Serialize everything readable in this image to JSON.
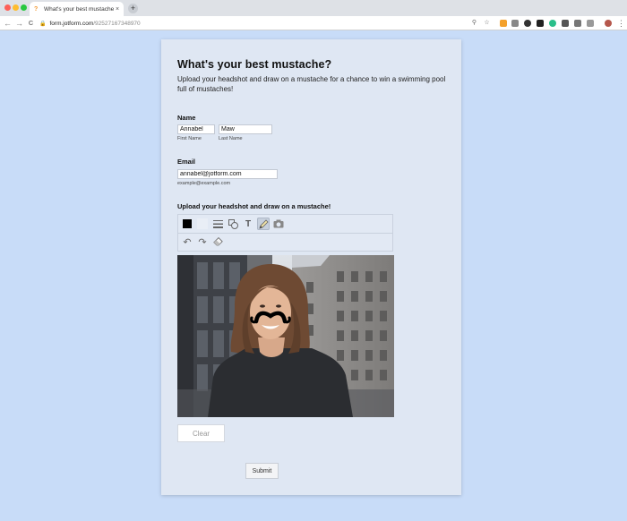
{
  "browser": {
    "tab_title": "What's your best mustache?",
    "tab_close": "×",
    "new_tab": "+",
    "url_host": "form.jotform.com",
    "url_path": "/92527167348970",
    "back": "←",
    "forward": "→",
    "reload": "C"
  },
  "form": {
    "title": "What's your best mustache?",
    "subtitle": "Upload your headshot and draw on a mustache for a chance to win a swimming pool full of mustaches!",
    "name_label": "Name",
    "first_name_value": "Annabel",
    "last_name_value": "Maw",
    "first_name_sublabel": "First Name",
    "last_name_sublabel": "Last Name",
    "email_label": "Email",
    "email_value": "annabel@jotform.com",
    "email_sublabel": "example@example.com",
    "upload_label": "Upload your headshot and draw on a mustache!",
    "clear_label": "Clear",
    "submit_label": "Submit"
  },
  "drawing_tools": {
    "text_tool_glyph": "T",
    "undo_glyph": "↶",
    "redo_glyph": "↷"
  },
  "colors": {
    "page_background": "#c8dcf8",
    "card_background": "#dfe7f3",
    "stroke_color": "#000000"
  }
}
